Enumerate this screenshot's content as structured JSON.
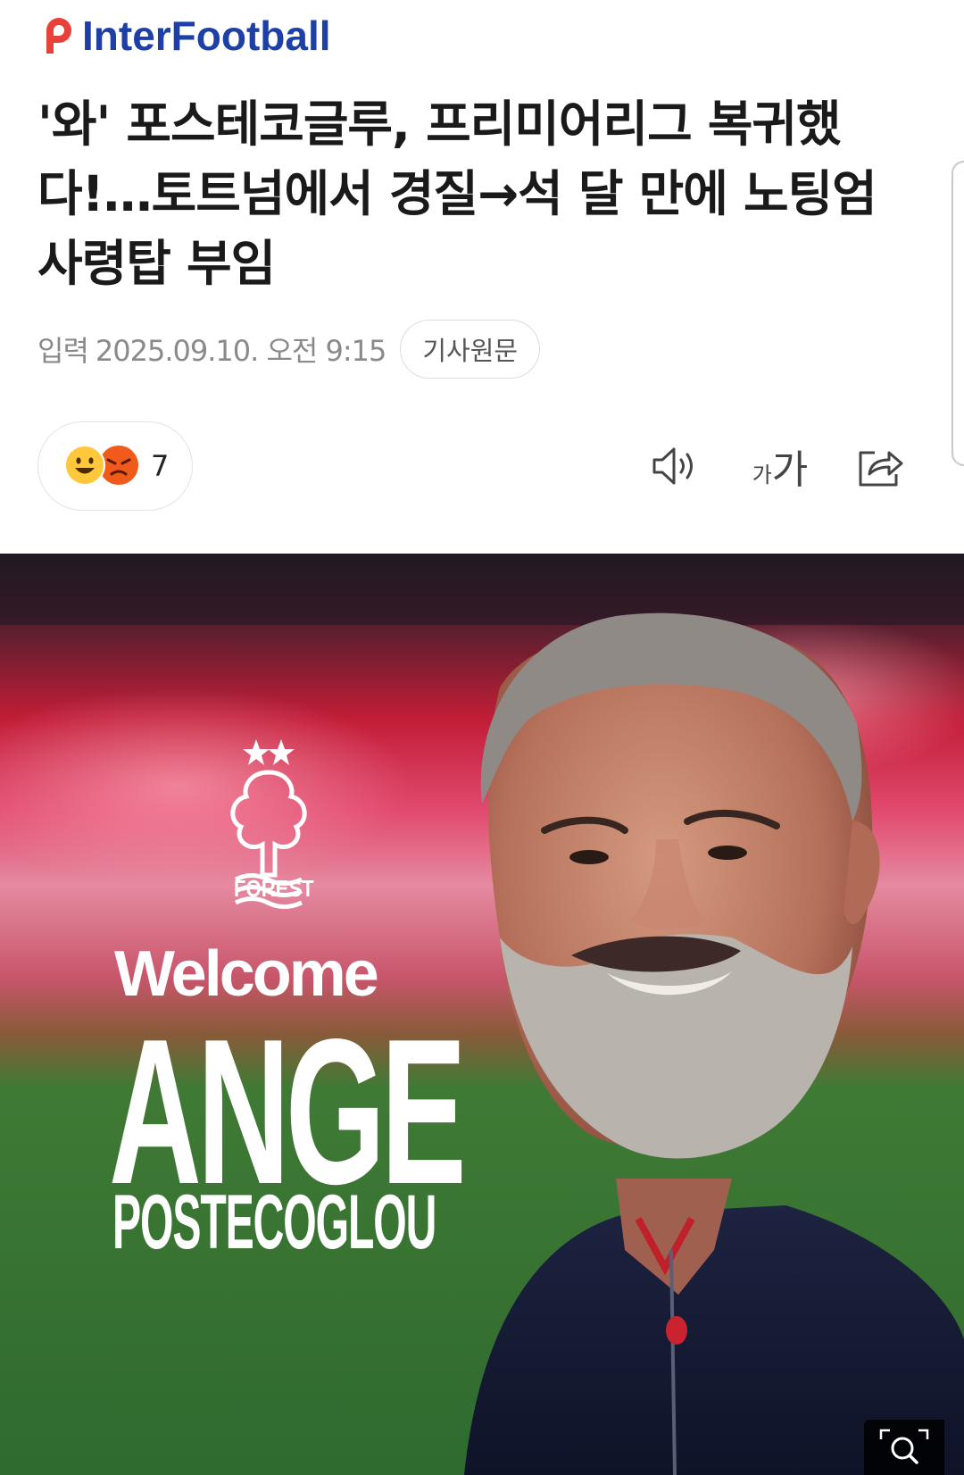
{
  "brand": {
    "name": "InterFootball",
    "logo_color": "#1e3fa6",
    "mark_color": "#e8413a"
  },
  "article": {
    "title": "'와' 포스테코글루, 프리미어리그 복귀했다!…토트넘에서 경질→석 달 만에 노팅엄 사령탑 부임",
    "title_lines": [
      "'와' 포스테코글루, 프리미어리그 복귀했",
      "다!…토트넘에서 경질→석 달 만에 노팅엄",
      "사령탑 부임"
    ],
    "meta_label": "입력",
    "published": "2025.09.10. 오전 9:15",
    "origin_button": "기사원문"
  },
  "actions": {
    "reaction_icons": [
      "happy-face-icon",
      "angry-face-icon"
    ],
    "reaction_count": "7",
    "audio_icon": "speaker-icon",
    "font_small": "가",
    "font_large": "가",
    "share_icon": "share-icon"
  },
  "image": {
    "welcome": "Welcome",
    "first_name": "ANGE",
    "last_name": "POSTECOGLOU",
    "club_word": "FOREST",
    "zoom_icon": "magnifier-icon"
  }
}
